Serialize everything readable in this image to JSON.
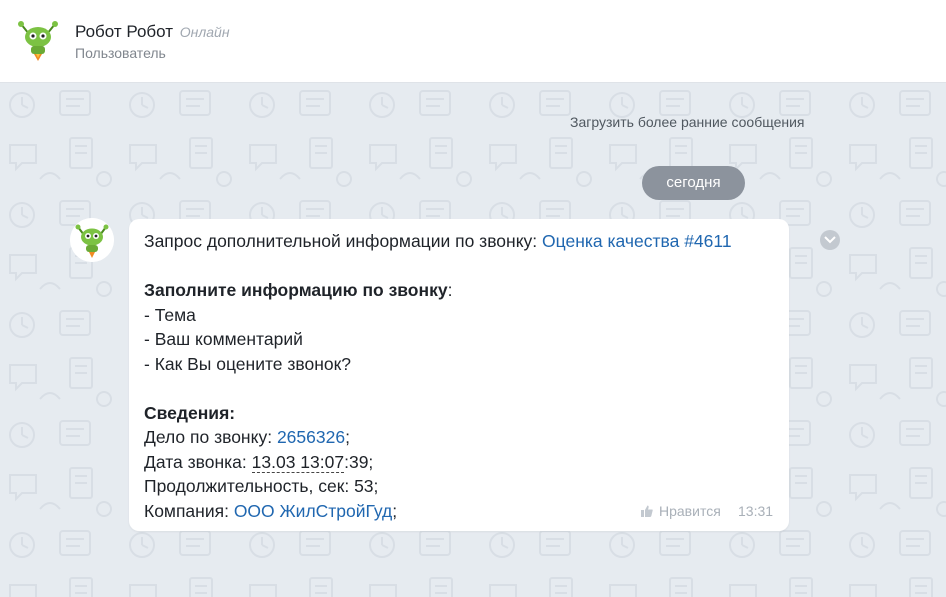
{
  "header": {
    "name": "Робот Робот",
    "status": "Онлайн",
    "role": "Пользователь",
    "avatar_icon": "robot-avatar-icon"
  },
  "chat": {
    "load_earlier": "Загрузить более ранние сообщения",
    "date_divider": "сегодня"
  },
  "message": {
    "intro_text": "Запрос дополнительной информации по звонку: ",
    "intro_link": "Оценка качества #4611",
    "fill_heading": "Заполните информацию по звонку",
    "fill_heading_suffix": ":",
    "fill_items": [
      "- Тема",
      "- Ваш комментарий",
      "- Как Вы оцените звонок?"
    ],
    "details_heading": "Сведения:",
    "case_label": "Дело по звонку: ",
    "case_value": "2656326",
    "case_suffix": ";",
    "date_label": "Дата звонка: ",
    "date_value": "13.03 13:07",
    "date_tail": ":39;",
    "duration_text": "Продолжительность, сек: 53;",
    "company_label": "Компания: ",
    "company_value": "ООО ЖилСтройГуд",
    "company_suffix": ";",
    "like_label": "Нравится",
    "time": "13:31"
  },
  "colors": {
    "link": "#2067b0",
    "background": "#e6ebf0",
    "date_pill": "#8c939d",
    "robot_green": "#7cc243"
  }
}
